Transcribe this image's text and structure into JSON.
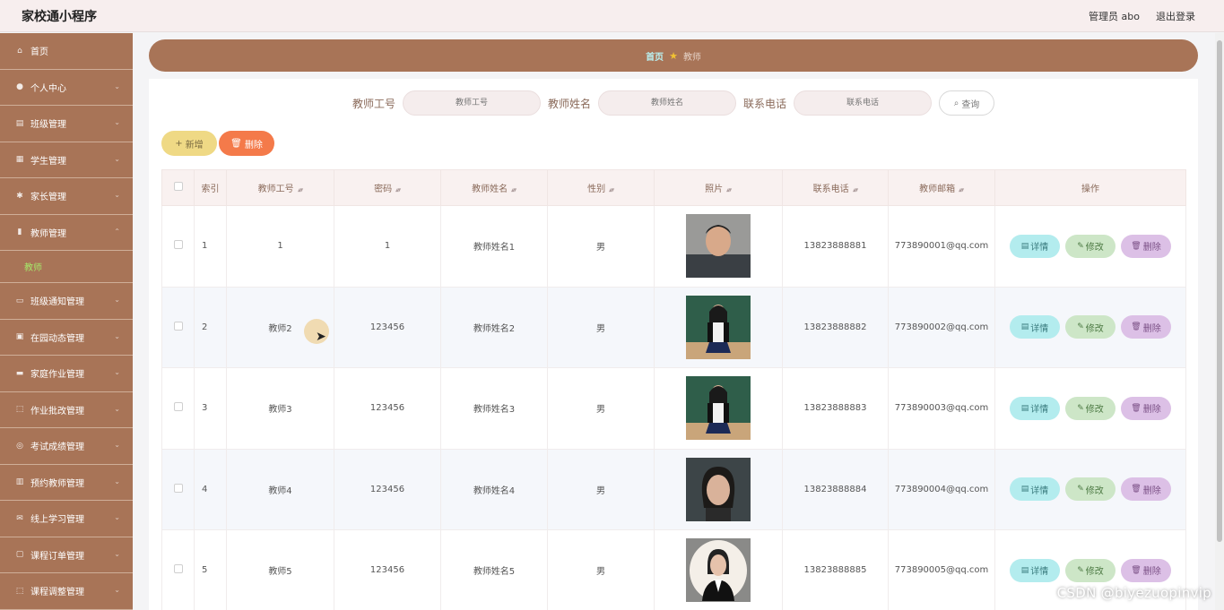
{
  "header": {
    "app_title": "家校通小程序",
    "admin_label": "管理员 abo",
    "logout_label": "退出登录"
  },
  "sidebar": {
    "items": [
      {
        "label": "首页",
        "icon": "home-icon",
        "glyph": "⌂",
        "chevron": false
      },
      {
        "label": "个人中心",
        "icon": "user-icon",
        "glyph": "●",
        "chevron": true
      },
      {
        "label": "班级管理",
        "icon": "class-icon",
        "glyph": "▤",
        "chevron": true
      },
      {
        "label": "学生管理",
        "icon": "grid-icon",
        "glyph": "▦",
        "chevron": true
      },
      {
        "label": "家长管理",
        "icon": "bulb-icon",
        "glyph": "✱",
        "chevron": true
      },
      {
        "label": "教师管理",
        "icon": "chart-icon",
        "glyph": "▮",
        "chevron": true,
        "expanded": true,
        "sub": "教师"
      },
      {
        "label": "班级通知管理",
        "icon": "monitor-icon",
        "glyph": "▭",
        "chevron": true
      },
      {
        "label": "在园动态管理",
        "icon": "cart-icon",
        "glyph": "▣",
        "chevron": true
      },
      {
        "label": "家庭作业管理",
        "icon": "ticket-icon",
        "glyph": "▬",
        "chevron": true
      },
      {
        "label": "作业批改管理",
        "icon": "frame-icon",
        "glyph": "⬚",
        "chevron": true
      },
      {
        "label": "考试成绩管理",
        "icon": "compass-icon",
        "glyph": "◎",
        "chevron": true
      },
      {
        "label": "预约教师管理",
        "icon": "document-icon",
        "glyph": "▥",
        "chevron": true
      },
      {
        "label": "线上学习管理",
        "icon": "mail-icon",
        "glyph": "✉",
        "chevron": true
      },
      {
        "label": "课程订单管理",
        "icon": "chat-icon",
        "glyph": "▢",
        "chevron": true
      },
      {
        "label": "课程调整管理",
        "icon": "crop-icon",
        "glyph": "⬚",
        "chevron": true
      }
    ]
  },
  "breadcrumb": {
    "home": "首页",
    "current": "教师"
  },
  "search": {
    "fields": [
      {
        "label": "教师工号",
        "placeholder": "教师工号"
      },
      {
        "label": "教师姓名",
        "placeholder": "教师姓名"
      },
      {
        "label": "联系电话",
        "placeholder": "联系电话"
      }
    ],
    "button": "查询"
  },
  "actions": {
    "add": "新增",
    "delete": "删除"
  },
  "table": {
    "columns": [
      {
        "label": "",
        "sortable": false
      },
      {
        "label": "索引",
        "sortable": false
      },
      {
        "label": "教师工号",
        "sortable": true
      },
      {
        "label": "密码",
        "sortable": true
      },
      {
        "label": "教师姓名",
        "sortable": true
      },
      {
        "label": "性别",
        "sortable": true
      },
      {
        "label": "照片",
        "sortable": true
      },
      {
        "label": "联系电话",
        "sortable": true
      },
      {
        "label": "教师邮箱",
        "sortable": true
      },
      {
        "label": "操作",
        "sortable": false
      }
    ],
    "op_labels": {
      "detail": "详情",
      "edit": "修改",
      "delete": "删除"
    },
    "rows": [
      {
        "index": "1",
        "id": "1",
        "password": "1",
        "name": "教师姓名1",
        "gender": "男",
        "photo": "photo-man",
        "phone": "13823888881",
        "email": "773890001@qq.com"
      },
      {
        "index": "2",
        "id": "教师2",
        "password": "123456",
        "name": "教师姓名2",
        "gender": "男",
        "photo": "photo-woman-classroom",
        "phone": "13823888882",
        "email": "773890002@qq.com"
      },
      {
        "index": "3",
        "id": "教师3",
        "password": "123456",
        "name": "教师姓名3",
        "gender": "男",
        "photo": "photo-woman-classroom",
        "phone": "13823888883",
        "email": "773890003@qq.com"
      },
      {
        "index": "4",
        "id": "教师4",
        "password": "123456",
        "name": "教师姓名4",
        "gender": "男",
        "photo": "photo-woman-portrait",
        "phone": "13823888884",
        "email": "773890004@qq.com"
      },
      {
        "index": "5",
        "id": "教师5",
        "password": "123456",
        "name": "教师姓名5",
        "gender": "男",
        "photo": "photo-woman-oval",
        "phone": "13823888885",
        "email": "773890005@qq.com"
      }
    ]
  },
  "watermark": "CSDN @biyezuopinvip",
  "colors": {
    "sidebar": "#a87457",
    "accent_add": "#efd985",
    "accent_delete": "#f47a4a",
    "active_sub": "#a6e86a"
  }
}
